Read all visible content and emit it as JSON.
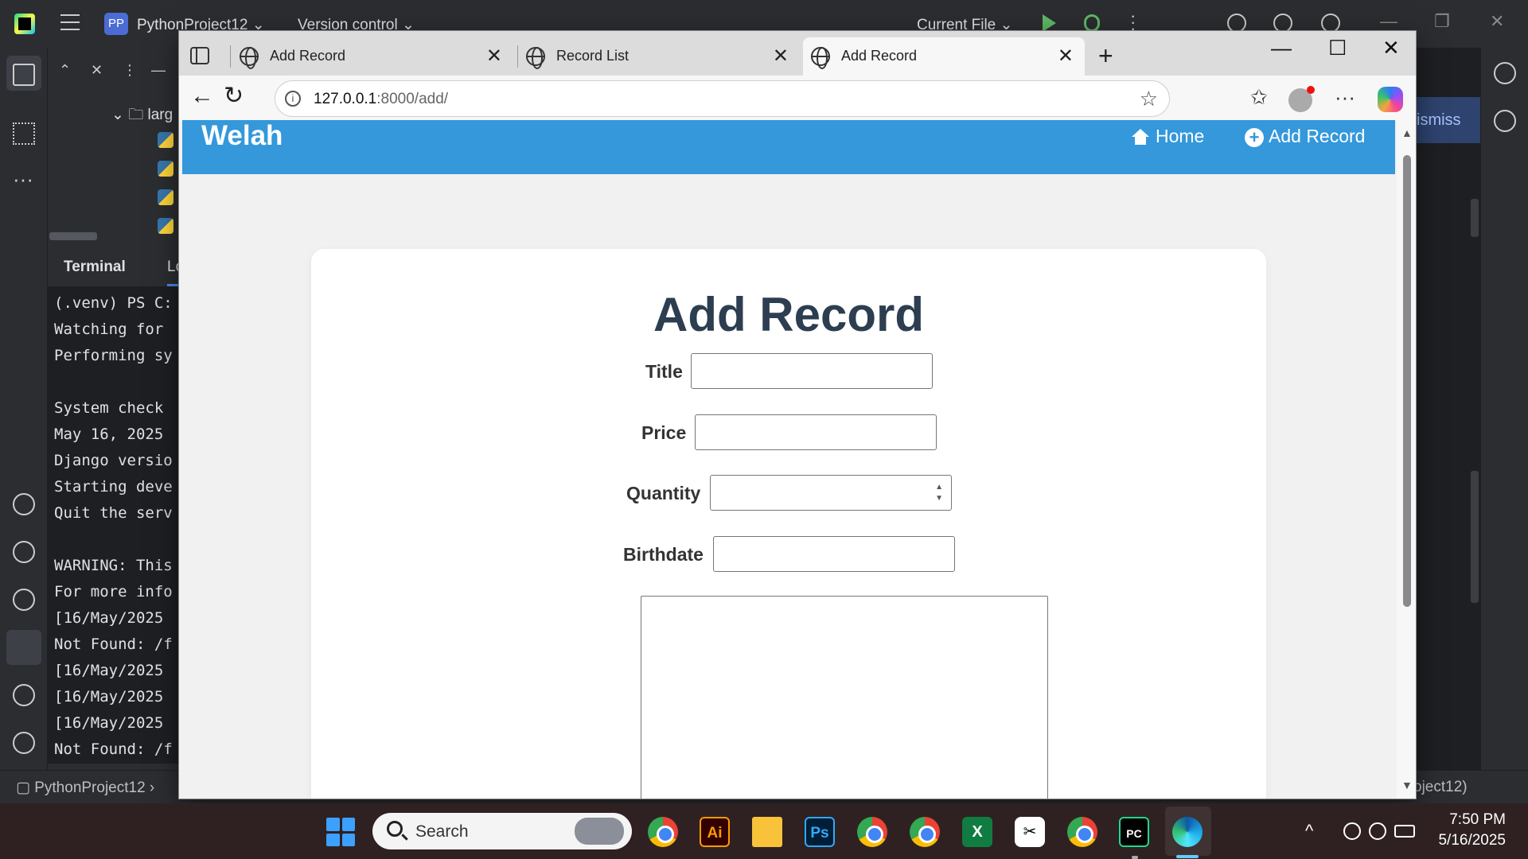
{
  "ide": {
    "project_badge": "PP",
    "project_name": "PythonProject12 ⌄",
    "vcs_label": "Version control ⌄",
    "current_file": "Current File ⌄",
    "tree_folder": "⌄ 🗀 larg",
    "terminal_tab": "Terminal",
    "terminal_tab2": "Lo",
    "terminal_lines": [
      "(.venv) PS C:",
      "Watching for",
      "Performing sy",
      "",
      "System check",
      "May 16, 2025",
      "Django versio",
      "Starting deve",
      "Quit the serv",
      "",
      "WARNING: This",
      "For more info",
      "[16/May/2025",
      "Not Found: /f",
      "[16/May/2025",
      "[16/May/2025",
      "[16/May/2025",
      "Not Found: /f"
    ],
    "dismiss_label": "ismiss",
    "status_project": "▢ PythonProject12 ›",
    "status_right": "oject12)"
  },
  "browser": {
    "tabs": [
      {
        "title": "Add Record",
        "active": false
      },
      {
        "title": "Record List",
        "active": false
      },
      {
        "title": "Add Record",
        "active": true
      }
    ],
    "address_host": "127.0.0.1",
    "address_path": ":8000/add/"
  },
  "site": {
    "brand": "Welah",
    "nav": {
      "home": "Home",
      "add_record": "Add Record"
    },
    "page_title": "Add Record",
    "form": {
      "title_label": "Title",
      "price_label": "Price",
      "quantity_label": "Quantity",
      "birthdate_label": "Birthdate",
      "title_value": "",
      "price_value": "",
      "quantity_value": "",
      "birthdate_value": ""
    },
    "colors": {
      "nav_bg": "#3498db",
      "title_color": "#2c3e50"
    }
  },
  "taskbar": {
    "search_placeholder": "Search",
    "apps": [
      "chrome-icon",
      "illustrator-icon",
      "file-explorer-icon",
      "photoshop-icon",
      "chrome-icon",
      "chrome-icon",
      "excel-icon",
      "capcut-icon",
      "chrome-icon",
      "pycharm-icon",
      "edge-icon"
    ],
    "ai_label": "Ai",
    "ps_label": "Ps",
    "excel_label": "X",
    "pycharm_label": "PC",
    "time": "7:50 PM",
    "date": "5/16/2025"
  }
}
